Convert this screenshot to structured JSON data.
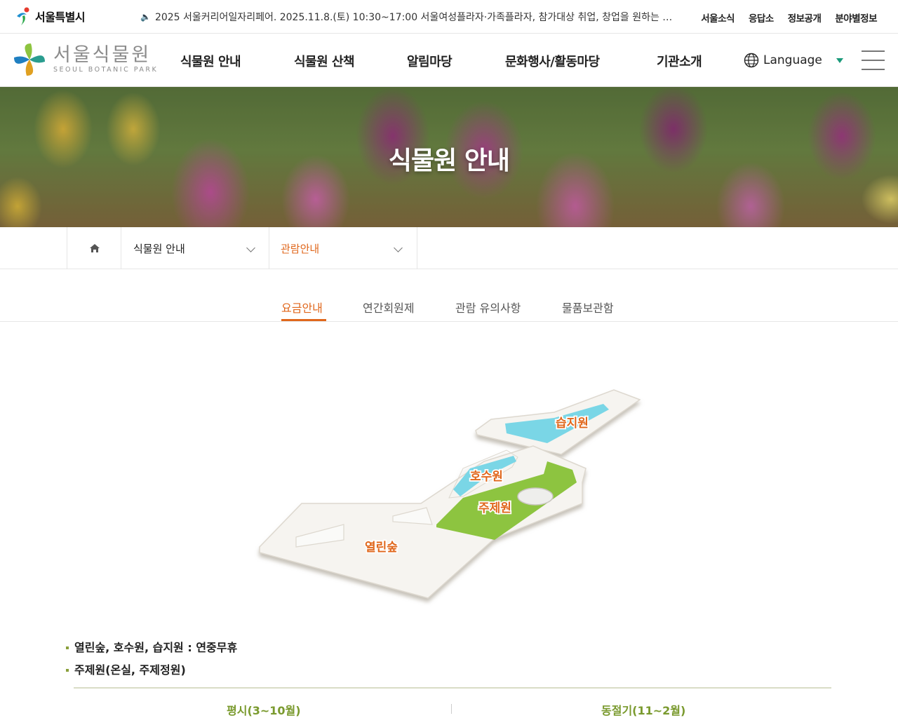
{
  "top_bar": {
    "city_logo": "서울특별시",
    "notice": "2025 서울커리어일자리페어. 2025.11.8.(토) 10:30~17:00 서울여성플라자·가족플라자, 참가대상 취업, 창업을 원하는 누구나",
    "utils": [
      "서울소식",
      "응답소",
      "정보공개",
      "분야별정보"
    ]
  },
  "header": {
    "logo_ko": "서울식물원",
    "logo_en": "SEOUL BOTANIC PARK",
    "nav": [
      "식물원 안내",
      "식물원 산책",
      "알림마당",
      "문화행사/활동마당",
      "기관소개"
    ],
    "language": "Language"
  },
  "hero": {
    "title": "식물원 안내"
  },
  "breadcrumb": {
    "depth1": "식물원 안내",
    "depth2": "관람안내"
  },
  "tabs": [
    "요금안내",
    "연간회원제",
    "관람 유의사항",
    "물품보관함"
  ],
  "map": {
    "labels": [
      "습지원",
      "호수원",
      "주제원",
      "열린숲"
    ]
  },
  "info": [
    "열린숲, 호수원, 습지원 : 연중무휴",
    "주제원(온실, 주제정원)"
  ],
  "seasons": [
    "평시(3~10월)",
    "동절기(11~2월)"
  ],
  "colors": {
    "accent": "#e0671c",
    "green": "#8dc43f",
    "water": "#7ad6e6"
  }
}
